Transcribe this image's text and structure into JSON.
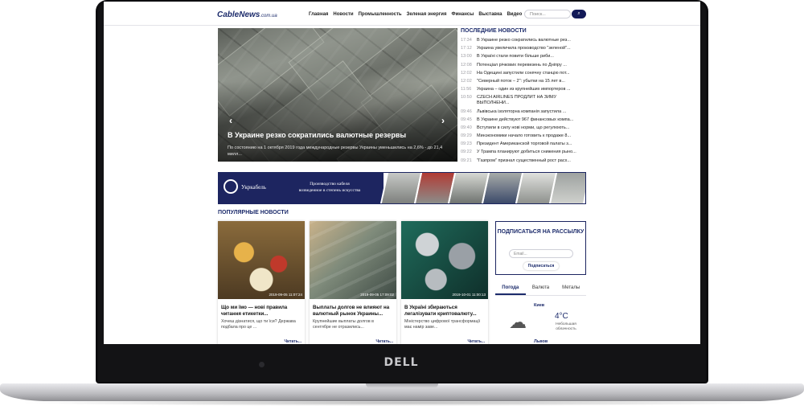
{
  "device": {
    "brand": "DELL"
  },
  "header": {
    "logo": "CableNews",
    "logo_suffix": ".com.ua",
    "nav": [
      "Главная",
      "Новости",
      "Промышленность",
      "Зеленая энергия",
      "Финансы",
      "Выставка",
      "Видео"
    ],
    "search_placeholder": "Поиск...",
    "search_icon": "search-icon"
  },
  "hero": {
    "title": "В Украине резко сократились валютные резервы",
    "subtitle": "По состоянию на 1 октября 2019 года международные резервы Украины уменьшились на 2,6% - до 21,4 милл...",
    "prev": "‹",
    "next": "›"
  },
  "latest": {
    "title": "ПОСЛЕДНИЕ НОВОСТИ",
    "items": [
      {
        "time": "17:34",
        "text": "В Украине резко сократились валютные рез..."
      },
      {
        "time": "17:12",
        "text": "Украина увеличила производство \"зеленой\"..."
      },
      {
        "time": "13:00",
        "text": "В Україні стали повити більше риби..."
      },
      {
        "time": "12:08",
        "text": "Потенціал річкових перевезень по Дніпру ..."
      },
      {
        "time": "12:02",
        "text": "На Одещині запустили сонячну станцію пот..."
      },
      {
        "time": "12:02",
        "text": "\"Северный поток – 2\": убытки на 15 лет в..."
      },
      {
        "time": "11:56",
        "text": "Украина – один из крупнейших импортеров ..."
      },
      {
        "time": "10:50",
        "text": "CZECH AIRLINES ПРОДЛИТ НА ЗИМУ ВЫПОЛНЕНИ..."
      },
      {
        "time": "09:46",
        "text": "Львівська ізоляторна компанія запустила ..."
      },
      {
        "time": "09:45",
        "text": "В Украине действуют 967 финансовых компа..."
      },
      {
        "time": "09:40",
        "text": "Вступили в силу нові норми, що регулюють..."
      },
      {
        "time": "09:29",
        "text": "Минэкономики начало готовить к продаже 8..."
      },
      {
        "time": "09:23",
        "text": "Президент Американской торговой палаты з..."
      },
      {
        "time": "09:22",
        "text": "У Трампа планируют добиться снижения рыно..."
      },
      {
        "time": "09:21",
        "text": "\"Газпром\" признал существенный рост расх..."
      }
    ]
  },
  "banner": {
    "brand": "Укркабель",
    "slogan_line1": "Производство кабеля",
    "slogan_line2": "возведенное в степень искусства"
  },
  "popular": {
    "title": "ПОПУЛЯРНЫЕ НОВОСТИ",
    "cards": [
      {
        "date": "2019-09-05 11:07:24",
        "title": "Що ми їмо — нові правила читання етикетки...",
        "text": "Хочеш дізнатися, що ти їси? Держава подбала про це ...",
        "more": "Читать..."
      },
      {
        "date": "2019-09-05 17:09:02",
        "title": "Выплаты долгов не влияют на валютный рынок Украины...",
        "text": "Крупнейшие выплаты долгов в сентябре не отразились...",
        "more": "Читать..."
      },
      {
        "date": "2019-10-01 11:00:13",
        "title": "В Україні збираються легалізувати криптовалюту...",
        "text": "Міністерство цифрової трансформації має намір заве...",
        "more": "Читать..."
      }
    ]
  },
  "subscribe": {
    "title": "ПОДПИСАТЬСЯ НА РАССЫЛКУ",
    "placeholder": "Email...",
    "button": "Подписаться"
  },
  "widget": {
    "tabs": [
      "Погода",
      "Валюта",
      "Металы"
    ],
    "active_tab": "Погода",
    "weather": [
      {
        "city": "Киев",
        "temp": "4°C",
        "desc": "Небольшая облачность",
        "icon": "cloud-icon"
      },
      {
        "city": "Львов"
      }
    ]
  }
}
